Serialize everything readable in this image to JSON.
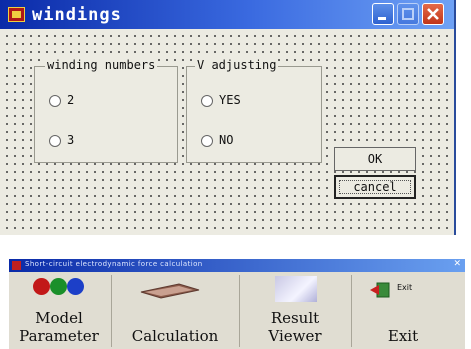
{
  "dialog": {
    "title": "windings",
    "groups": {
      "winding_numbers": {
        "legend": "winding numbers",
        "options": [
          "2",
          "3"
        ]
      },
      "v_adjusting": {
        "legend": "V adjusting",
        "options": [
          "YES",
          "NO"
        ]
      }
    },
    "buttons": {
      "ok": "OK",
      "cancel": "cancel"
    }
  },
  "toolbar": {
    "title": "Short-circuit electrodynamic force calculation",
    "buttons": [
      {
        "line1": "Model",
        "line2": "Parameter",
        "icon": "model-icon"
      },
      {
        "line1": "Calculation",
        "icon": "calculation-icon"
      },
      {
        "line1": "Result",
        "line2": "Viewer",
        "icon": "viewer-icon"
      },
      {
        "line1": "Exit",
        "icon_text": "Exit",
        "icon": "exit-icon"
      }
    ]
  },
  "colors": {
    "title_bar": "#0a2aa8",
    "face": "#ecebe2",
    "close_button": "#c1351a"
  }
}
